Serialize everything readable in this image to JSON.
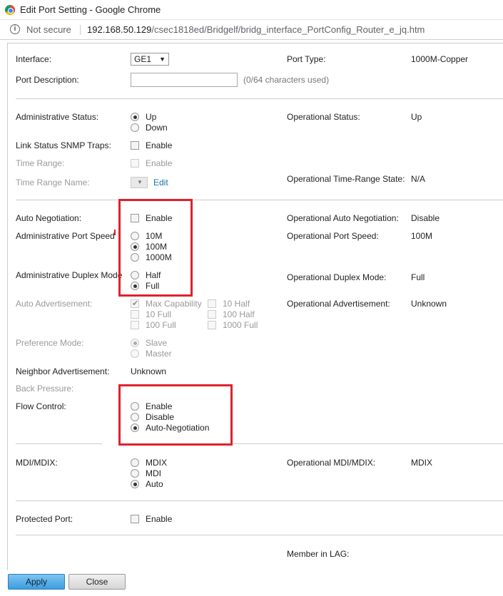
{
  "window": {
    "title": "Edit Port Setting - Google Chrome",
    "not_secure": "Not secure",
    "url_host": "192.168.50.129",
    "url_path": "/csec1818ed/Bridgelf/bridg_interface_PortConfig_Router_e_jq.htm"
  },
  "interface": {
    "label": "Interface:",
    "value": "GE1"
  },
  "port_type": {
    "label": "Port Type:",
    "value": "1000M-Copper"
  },
  "port_description": {
    "label": "Port Description:",
    "value": "",
    "counter": "(0/64 characters used)"
  },
  "admin_status": {
    "label": "Administrative Status:",
    "options": [
      "Up",
      "Down"
    ],
    "selected": "Up"
  },
  "oper_status": {
    "label": "Operational Status:",
    "value": "Up"
  },
  "link_snmp": {
    "label": "Link Status SNMP Traps:",
    "option": "Enable"
  },
  "time_range": {
    "label": "Time Range:",
    "option": "Enable"
  },
  "time_range_name": {
    "label": "Time Range Name:",
    "edit": "Edit"
  },
  "oper_time_range": {
    "label": "Operational Time-Range State:",
    "value": "N/A"
  },
  "auto_neg": {
    "label": "Auto Negotiation:",
    "option": "Enable"
  },
  "oper_auto_neg": {
    "label": "Operational Auto Negotiation:",
    "value": "Disable"
  },
  "admin_speed": {
    "label": "Administrative Port Speed",
    "options": [
      "10M",
      "100M",
      "1000M"
    ],
    "selected": "100M"
  },
  "oper_speed": {
    "label": "Operational Port Speed:",
    "value": "100M"
  },
  "admin_duplex": {
    "label": "Administrative Duplex Mode",
    "options": [
      "Half",
      "Full"
    ],
    "selected": "Full"
  },
  "oper_duplex": {
    "label": "Operational Duplex Mode:",
    "value": "Full"
  },
  "auto_adv": {
    "label": "Auto Advertisement:",
    "col1": [
      "Max Capability",
      "10 Full",
      "100 Full"
    ],
    "col2": [
      "10 Half",
      "100 Half",
      "1000 Full"
    ]
  },
  "oper_adv": {
    "label": "Operational Advertisement:",
    "value": "Unknown"
  },
  "pref_mode": {
    "label": "Preference Mode:",
    "options": [
      "Slave",
      "Master"
    ]
  },
  "neighbor_adv": {
    "label": "Neighbor Advertisement:",
    "value": "Unknown"
  },
  "back_pressure": {
    "label": "Back Pressure:"
  },
  "flow_control": {
    "label": "Flow Control:",
    "options": [
      "Enable",
      "Disable",
      "Auto-Negotiation"
    ],
    "selected": "Auto-Negotiation"
  },
  "mdi": {
    "label": "MDI/MDIX:",
    "options": [
      "MDIX",
      "MDI",
      "Auto"
    ],
    "selected": "Auto"
  },
  "oper_mdi": {
    "label": "Operational MDI/MDIX:",
    "value": "MDIX"
  },
  "protected_port": {
    "label": "Protected Port:",
    "option": "Enable"
  },
  "member_lag": {
    "label": "Member in LAG:"
  },
  "buttons": {
    "apply": "Apply",
    "close": "Close"
  },
  "colors": {
    "highlight": "#e0202e",
    "link": "#1a73a8",
    "apply": "#3d9ce0"
  },
  "icons": {
    "browser": "chrome-icon",
    "info": "info-icon",
    "dropdown": "chevron-down-icon"
  }
}
